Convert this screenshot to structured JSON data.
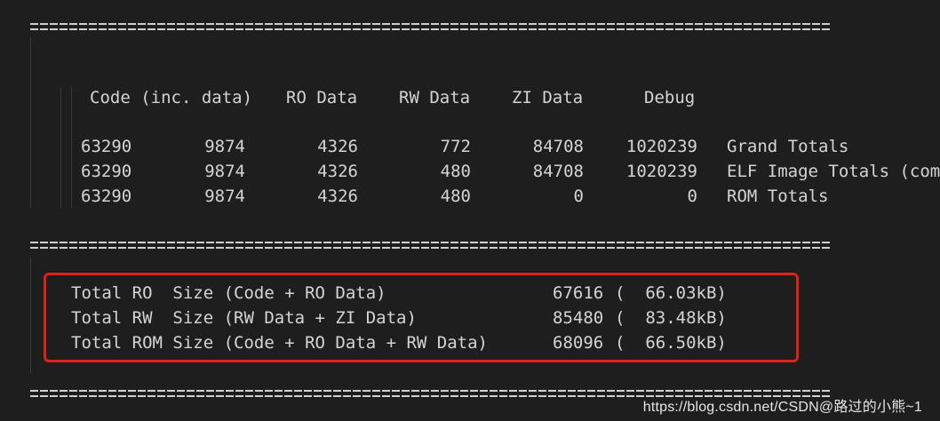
{
  "separator_char": "=",
  "headers": {
    "code": "Code (inc. data)",
    "ro": "RO Data",
    "rw": "RW Data",
    "zi": "ZI Data",
    "debug": "Debug"
  },
  "rows": [
    {
      "code": "63290",
      "inc": "9874",
      "ro": "4326",
      "rw": "772",
      "zi": "84708",
      "debug": "1020239",
      "label": "Grand Totals"
    },
    {
      "code": "63290",
      "inc": "9874",
      "ro": "4326",
      "rw": "480",
      "zi": "84708",
      "debug": "1020239",
      "label": "ELF Image Totals (com"
    },
    {
      "code": "63290",
      "inc": "9874",
      "ro": "4326",
      "rw": "480",
      "zi": "0",
      "debug": "0",
      "label": "ROM Totals"
    }
  ],
  "summary": [
    {
      "label": "Total RO  Size (Code + RO Data)",
      "bytes": "67616",
      "kb": "(  66.03kB)"
    },
    {
      "label": "Total RW  Size (RW Data + ZI Data)",
      "bytes": "85480",
      "kb": "(  83.48kB)"
    },
    {
      "label": "Total ROM Size (Code + RO Data + RW Data)",
      "bytes": "68096",
      "kb": "(  66.50kB)"
    }
  ],
  "watermark": "https://blog.csdn.net/CSDN@路过的小熊~1",
  "colors": {
    "highlight": "#e0201a",
    "background": "#1e1e1e",
    "text": "#d4d4d4"
  }
}
